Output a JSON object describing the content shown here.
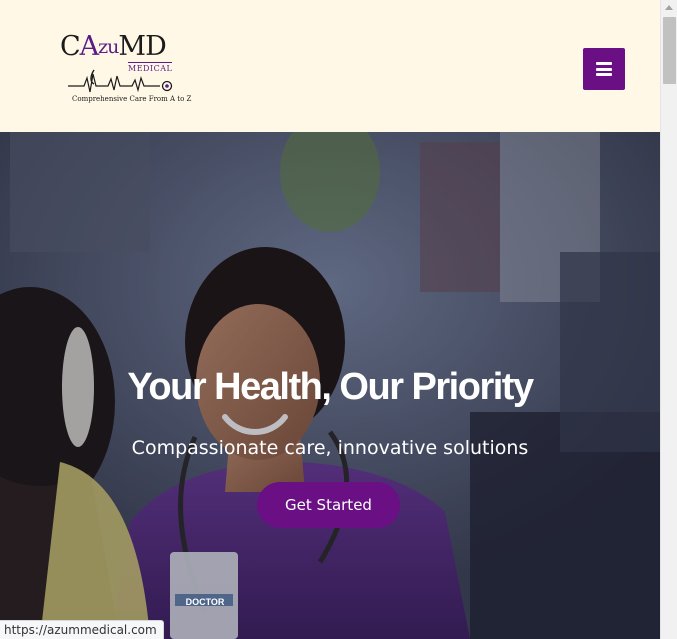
{
  "header": {
    "logo": {
      "wordmark_part1": "C",
      "wordmark_part2": "A",
      "wordmark_part3": "zu",
      "wordmark_part4": "MD",
      "subline": "MEDICAL",
      "tagline": "Comprehensive Care From A to Z"
    },
    "menu_icon": "hamburger-menu-icon"
  },
  "hero": {
    "title": "Your Health, Our Priority",
    "subtitle": "Compassionate care, innovative solutions",
    "cta_label": "Get Started",
    "badge_text": "DOCTOR"
  },
  "status_bar": {
    "url": "https://azummedical.com"
  },
  "colors": {
    "brand_purple": "#6a0f84",
    "header_bg": "#fff8e7",
    "scrubs_purple": "#5b2a8c"
  }
}
